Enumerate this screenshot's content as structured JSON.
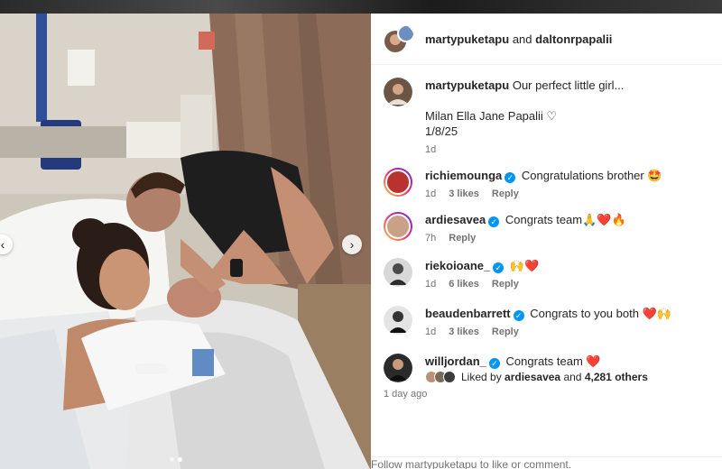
{
  "header": {
    "user1": "martypuketapu",
    "and": "and",
    "user2": "daltonrpapalii"
  },
  "caption": {
    "user": "martypuketapu",
    "text": "Our perfect little girl...",
    "line2": "Milan Ella Jane Papalii ♡",
    "line3": "1/8/25",
    "time": "1d"
  },
  "comments": [
    {
      "user": "richiemounga",
      "verified": true,
      "text": "Congratulations brother 🤩",
      "time": "1d",
      "likes": "3 likes",
      "reply": "Reply",
      "story": true
    },
    {
      "user": "ardiesavea",
      "verified": true,
      "text": "Congrats team🙏❤️🔥",
      "time": "7h",
      "likes": "",
      "reply": "Reply",
      "story": true
    },
    {
      "user": "riekoioane_",
      "verified": true,
      "text": "🙌❤️",
      "time": "1d",
      "likes": "6 likes",
      "reply": "Reply",
      "story": false
    },
    {
      "user": "beaudenbarrett",
      "verified": true,
      "text": "Congrats to you both ❤️🙌",
      "time": "1d",
      "likes": "3 likes",
      "reply": "Reply",
      "story": false
    },
    {
      "user": "willjordan_",
      "verified": true,
      "text": "Congrats team ❤️",
      "time": "",
      "likes": "",
      "reply": "",
      "story": false
    }
  ],
  "likes": {
    "prefix": "Liked by",
    "user": "ardiesavea",
    "and": "and",
    "count": "4,281 others",
    "time": "1 day ago"
  },
  "footer": {
    "text": "Follow martypuketapu to like or comment."
  },
  "carousel": {
    "prev_icon": "chevron-left-icon",
    "next_icon": "chevron-right-icon",
    "current_slide": 2,
    "total_slides": 2
  },
  "colors": {
    "verified": "#0095f6",
    "muted": "#737373",
    "text": "#262626"
  }
}
